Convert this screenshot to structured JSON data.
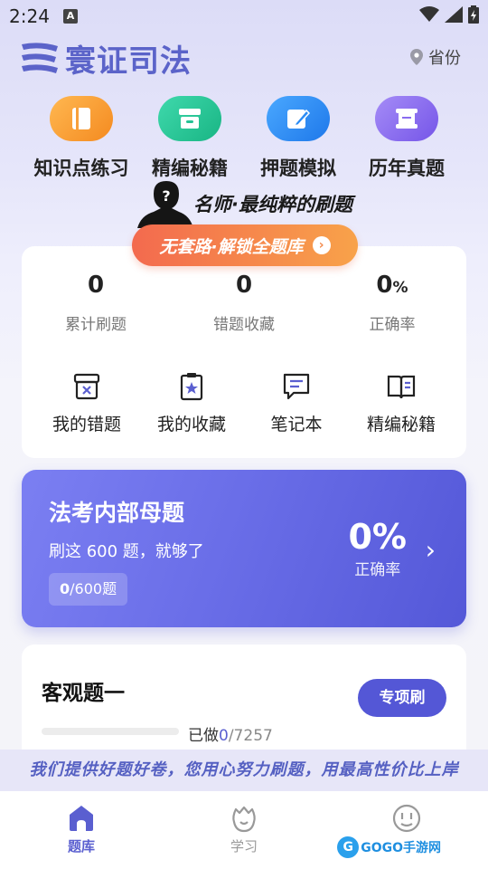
{
  "status_bar": {
    "time": "2:24",
    "notification_badge": "A"
  },
  "header": {
    "brand": "寰证司法",
    "province_label": "省份"
  },
  "quick_menu": [
    {
      "label": "知识点练习",
      "icon": "book-icon",
      "color": "#f8a03c"
    },
    {
      "label": "精编秘籍",
      "icon": "archive-box-icon",
      "color": "#27c497"
    },
    {
      "label": "押题模拟",
      "icon": "pencil-edit-icon",
      "color": "#2b8cf5"
    },
    {
      "label": "历年真题",
      "icon": "scroll-icon",
      "color": "#8a6cf0"
    }
  ],
  "promo": {
    "tagline": "名师·最纯粹的刷题",
    "button": "无套路·解锁全题库"
  },
  "stats": [
    {
      "value": "0",
      "unit": "",
      "label": "累计刷题"
    },
    {
      "value": "0",
      "unit": "",
      "label": "错题收藏"
    },
    {
      "value": "0",
      "unit": "%",
      "label": "正确率"
    }
  ],
  "tools": [
    {
      "label": "我的错题",
      "icon": "wrong-box-icon"
    },
    {
      "label": "我的收藏",
      "icon": "star-clipboard-icon"
    },
    {
      "label": "笔记本",
      "icon": "note-icon"
    },
    {
      "label": "精编秘籍",
      "icon": "open-book-icon"
    }
  ],
  "exam_card": {
    "title": "法考内部母题",
    "subtitle": "刷这 600 题，就够了",
    "done": "0",
    "total": "/600题",
    "rate": "0%",
    "rate_label": "正确率"
  },
  "objective_card": {
    "title": "客观题一",
    "button": "专项刷",
    "done_prefix": "已做",
    "done": "0",
    "total": "/7257",
    "progress": 0
  },
  "slogan": "我们提供好题好卷，您用心努力刷题，用最高性价比上岸",
  "tabbar": [
    {
      "label": "题库",
      "icon": "home-icon",
      "active": true
    },
    {
      "label": "学习",
      "icon": "flame-icon",
      "active": false
    },
    {
      "label": "",
      "icon": "smiley-icon",
      "active": false
    }
  ],
  "watermark": "GOGO手游网",
  "colors": {
    "primary": "#5a5fd0",
    "promo_start": "#f36a4e",
    "promo_end": "#f8a24a"
  }
}
